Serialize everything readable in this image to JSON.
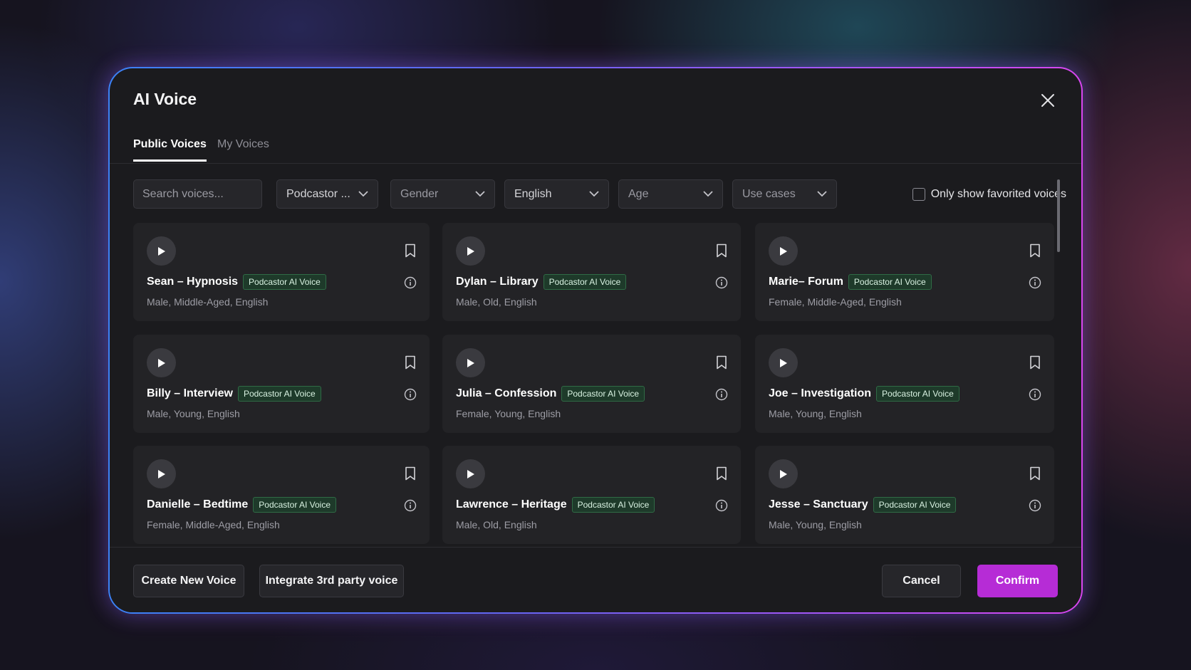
{
  "dialog": {
    "title": "AI Voice"
  },
  "tabs": [
    {
      "label": "Public Voices",
      "active": true
    },
    {
      "label": "My Voices",
      "active": false
    }
  ],
  "filters": {
    "search_placeholder": "Search voices...",
    "selects": [
      {
        "label": "Podcastor ...",
        "name": "provider"
      },
      {
        "label": "Gender",
        "name": "gender"
      },
      {
        "label": "English",
        "name": "language"
      },
      {
        "label": "Age",
        "name": "age"
      },
      {
        "label": "Use cases",
        "name": "use-cases"
      }
    ],
    "favorites_label": "Only show favorited voices",
    "favorites_checked": false
  },
  "voices": [
    {
      "name": "Sean – Hypnosis",
      "badge": "Podcastor AI Voice",
      "desc": "Male, Middle-Aged, English"
    },
    {
      "name": "Dylan – Library",
      "badge": "Podcastor AI Voice",
      "desc": "Male, Old, English"
    },
    {
      "name": "Marie– Forum",
      "badge": "Podcastor AI Voice",
      "desc": "Female, Middle-Aged, English"
    },
    {
      "name": "Billy – Interview",
      "badge": "Podcastor AI Voice",
      "desc": "Male, Young, English"
    },
    {
      "name": "Julia – Confession",
      "badge": "Podcastor AI Voice",
      "desc": "Female, Young, English"
    },
    {
      "name": "Joe – Investigation",
      "badge": "Podcastor AI Voice",
      "desc": "Male, Young, English"
    },
    {
      "name": "Danielle – Bedtime",
      "badge": "Podcastor AI Voice",
      "desc": "Female, Middle-Aged, English"
    },
    {
      "name": "Lawrence – Heritage",
      "badge": "Podcastor AI Voice",
      "desc": "Male, Old, English"
    },
    {
      "name": "Jesse – Sanctuary",
      "badge": "Podcastor AI Voice",
      "desc": "Male, Young, English"
    }
  ],
  "footer": {
    "create_label": "Create New Voice",
    "integrate_label": "Integrate 3rd party voice",
    "cancel_label": "Cancel",
    "confirm_label": "Confirm"
  },
  "colors": {
    "accent": "#b62cd6",
    "badge_bg": "#1e3a2a",
    "badge_border": "#2f6b45"
  },
  "icons": {
    "close": "close-icon",
    "play": "play-icon",
    "bookmark": "bookmark-icon",
    "info": "info-icon",
    "chevron": "chevron-down-icon"
  }
}
